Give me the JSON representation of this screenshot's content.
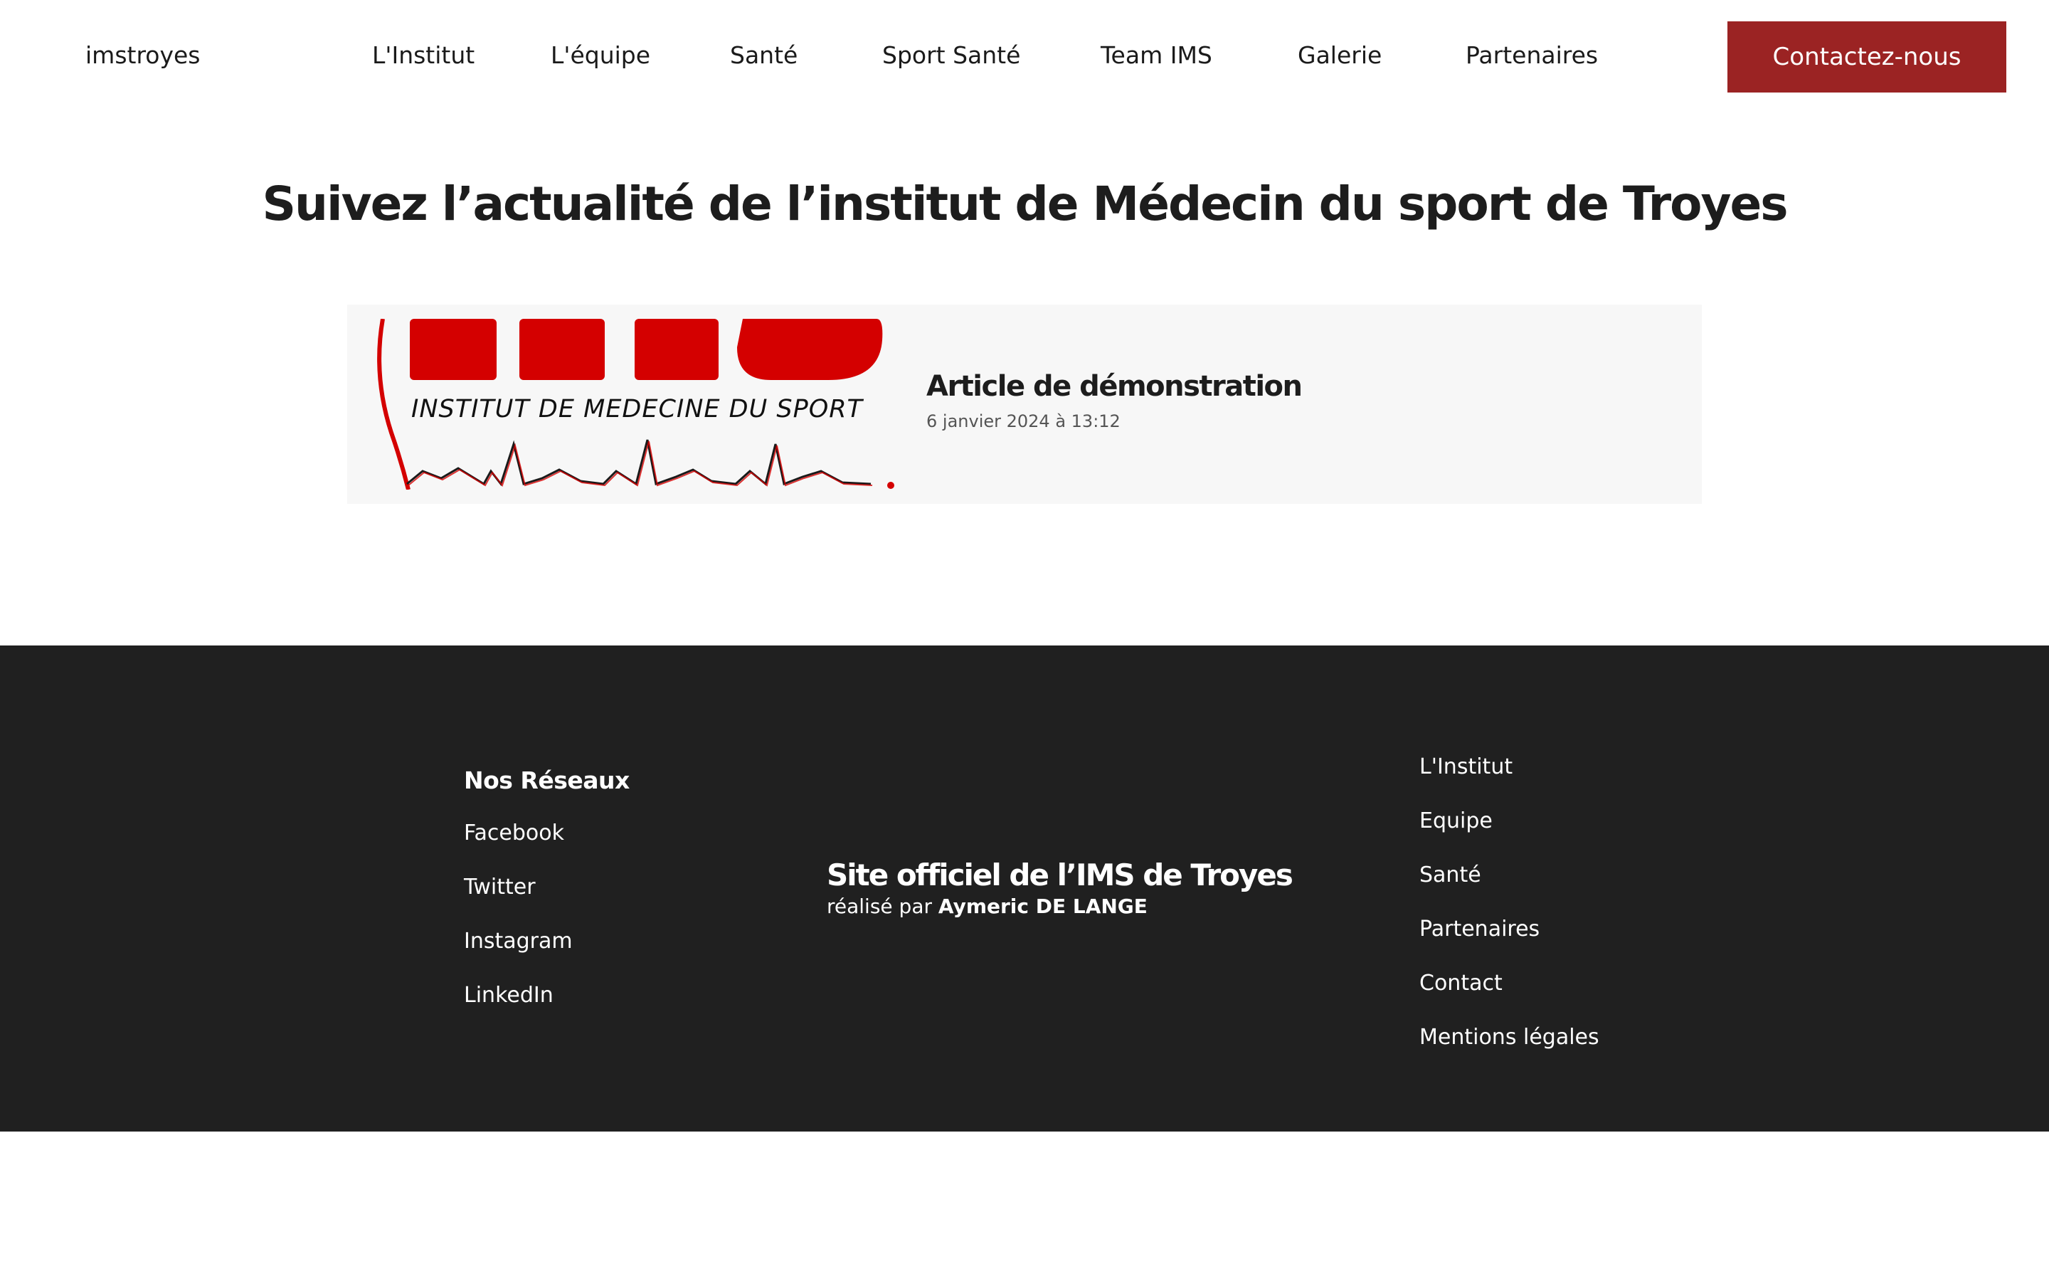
{
  "header": {
    "brand": "imstroyes",
    "nav": [
      {
        "label": "L'Institut"
      },
      {
        "label": "L'équipe"
      },
      {
        "label": "Santé"
      },
      {
        "label": "Sport Santé"
      },
      {
        "label": "Team IMS"
      },
      {
        "label": "Galerie"
      },
      {
        "label": "Partenaires"
      }
    ],
    "cta_label": "Contactez-nous"
  },
  "main": {
    "title": "Suivez l’actualité de l’institut de Médecin du sport de Troyes",
    "posts": [
      {
        "title": "Article de démonstration",
        "date": "6 janvier 2024 à 13:12",
        "image_text": "INSTITUT DE MEDECINE DU SPORT"
      }
    ]
  },
  "footer": {
    "social_heading": "Nos Réseaux",
    "social_links": [
      {
        "label": "Facebook"
      },
      {
        "label": "Twitter"
      },
      {
        "label": "Instagram"
      },
      {
        "label": "LinkedIn"
      }
    ],
    "site_title": "Site officiel de l’IMS de Troyes",
    "credit_prefix": "réalisé par",
    "credit_author": "Aymeric DE LANGE",
    "links": [
      {
        "label": "L'Institut"
      },
      {
        "label": "Equipe"
      },
      {
        "label": "Santé"
      },
      {
        "label": "Partenaires"
      },
      {
        "label": "Contact"
      },
      {
        "label": "Mentions légales"
      }
    ]
  },
  "colors": {
    "accent": "#9b2323",
    "logo_red": "#d40000",
    "footer_bg": "#202020",
    "card_bg": "#f7f7f7"
  }
}
